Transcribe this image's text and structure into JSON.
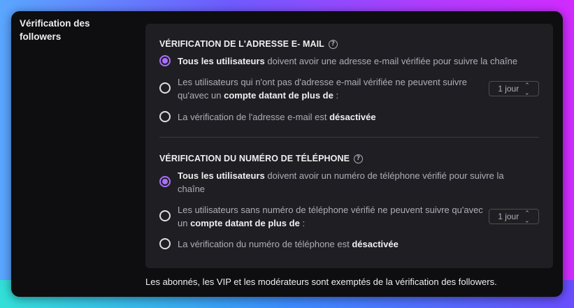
{
  "section": {
    "label": "Vérification des followers"
  },
  "email": {
    "title": "VÉRIFICATION DE L'ADRESSE E- MAIL",
    "opt1_bold": "Tous les utilisateurs",
    "opt1_rest": " doivent avoir une adresse e-mail vérifiée pour suivre la chaîne",
    "opt2_pre": "Les utilisateurs qui n'ont pas d'adresse e-mail vérifiée ne peuvent suivre qu'avec un ",
    "opt2_bold": "compte datant de plus de",
    "opt2_post": " :",
    "opt2_select": "1 jour",
    "opt3_pre": "La vérification de l'adresse e-mail est ",
    "opt3_bold": "désactivée",
    "selected": 1
  },
  "phone": {
    "title": "VÉRIFICATION DU NUMÉRO DE TÉLÉPHONE",
    "opt1_bold": "Tous les utilisateurs",
    "opt1_rest": " doivent avoir un numéro de téléphone vérifié pour suivre la chaîne",
    "opt2_pre": "Les utilisateurs sans numéro de téléphone vérifié ne peuvent suivre qu'avec un ",
    "opt2_bold": "compte datant de plus de",
    "opt2_post": " :",
    "opt2_select": "1 jour",
    "opt3_pre": "La vérification du numéro de téléphone est ",
    "opt3_bold": "désactivée",
    "selected": 1
  },
  "footnote": "Les abonnés, les VIP et les modérateurs sont exemptés de la vérification des followers.",
  "colors": {
    "accent": "#a970ff",
    "background": "#0e0e10",
    "panel": "#1f1f23"
  }
}
